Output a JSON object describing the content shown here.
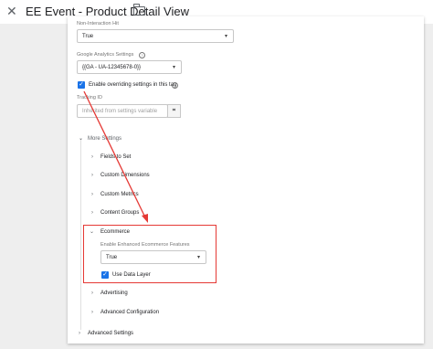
{
  "window": {
    "title": "EE Event - Product Detail View"
  },
  "non_interaction": {
    "label": "Non-Interaction Hit",
    "value": "True"
  },
  "ga_settings": {
    "label": "Google Analytics Settings",
    "value": "{{GA - UA-12345678-0}}"
  },
  "override": {
    "label": "Enable overriding settings in this tag",
    "checked": true
  },
  "tracking": {
    "label": "Tracking ID",
    "placeholder": "Inherited from settings variable"
  },
  "more_settings": {
    "label": "More Settings",
    "items": [
      "Fields to Set",
      "Custom Dimensions",
      "Custom Metrics",
      "Content Groups"
    ]
  },
  "ecommerce": {
    "label": "Ecommerce",
    "enable_label": "Enable Enhanced Ecommerce Features",
    "enable_value": "True",
    "data_layer_label": "Use Data Layer"
  },
  "more_items": [
    "Advertising",
    "Advanced Configuration"
  ],
  "advanced_settings": {
    "label": "Advanced Settings"
  },
  "colors": {
    "accent": "#1a73e8",
    "highlight": "#e53935"
  },
  "icons": {
    "close": "close-icon",
    "folder": "folder-icon",
    "help": "help-icon",
    "variable": "variable-icon"
  }
}
